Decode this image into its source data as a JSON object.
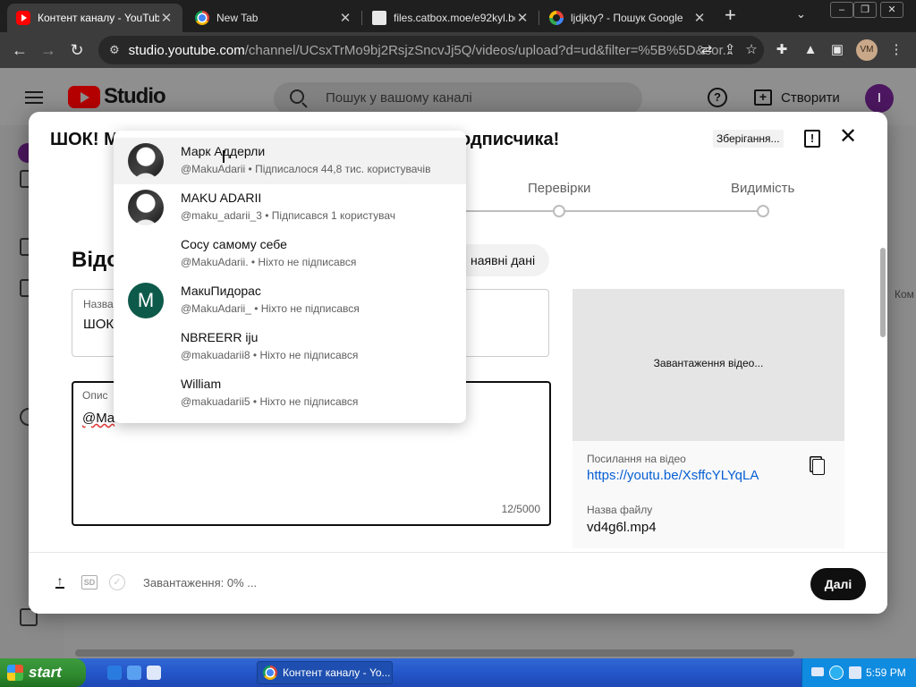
{
  "browser": {
    "tabs": [
      {
        "title": "Контент каналу - YouTube",
        "favicon": "youtube-icon",
        "active": true
      },
      {
        "title": "New Tab",
        "favicon": "chrome-icon",
        "active": false
      },
      {
        "title": "files.catbox.moe/e92kyl.bd",
        "favicon": "file-icon",
        "active": false
      },
      {
        "title": "ljdjkty? - Пошук Google",
        "favicon": "google-icon",
        "active": false
      }
    ],
    "url_host": "studio.youtube.com",
    "url_path": "/channel/UCsxTrMo9bj2RsjzSncvJj5Q/videos/upload?d=ud&filter=%5B%5D&sor...",
    "profile_initials": "VM"
  },
  "studio": {
    "logo_text": "Studio",
    "search_placeholder": "Пошук у вашому каналі",
    "create_label": "Створити",
    "avatar_letter": "I",
    "right_peek": "Ком"
  },
  "dialog": {
    "title_start": "ШОК! М",
    "title_end": "одписчика!",
    "save_status": "Зберігання...",
    "steps": [
      {
        "label": "Перевірки"
      },
      {
        "label": "Видимість"
      }
    ],
    "details_heading": "Відо",
    "reuse_chip": "наявні дані",
    "title_field": {
      "label": "Назва",
      "value": "ШОК"
    },
    "description_field": {
      "label": "Опис",
      "value": "@Ma",
      "char_count": "12/5000"
    },
    "preview": {
      "loading_text": "Завантаження відео...",
      "link_label": "Посилання на відео",
      "link_url": "https://youtu.be/XsffcYLYqLA",
      "file_label": "Назва файлу",
      "file_name": "vd4g6l.mp4"
    },
    "footer": {
      "sd_badge": "SD",
      "upload_status": "Завантаження: 0% ...",
      "next_label": "Далі"
    }
  },
  "mention_suggestions": [
    {
      "name": "Марк Аддерли",
      "handle": "@MakuAdarii",
      "subs": "Підписалося 44,8 тис. користувачів",
      "avatar": "manga"
    },
    {
      "name": "MAKU ADARII",
      "handle": "@maku_adarii_3",
      "subs": "Підписався 1 користувач",
      "avatar": "manga"
    },
    {
      "name": "Сосу самому себе",
      "handle": "@MakuAdarii.",
      "subs": "Ніхто не підписався",
      "avatar": "none"
    },
    {
      "name": "МакuПидорас",
      "handle": "@MakuAdarii_",
      "subs": "Ніхто не підписався",
      "avatar": "letter",
      "letter": "M"
    },
    {
      "name": "NBREERR iju",
      "handle": "@makuadarii8",
      "subs": "Ніхто не підписався",
      "avatar": "none"
    },
    {
      "name": "William",
      "handle": "@makuadarii5",
      "subs": "Ніхто не підписався",
      "avatar": "none"
    }
  ],
  "taskbar": {
    "start_label": "start",
    "task_title": "Контент каналу - Yo...",
    "clock": "5:59 PM"
  }
}
